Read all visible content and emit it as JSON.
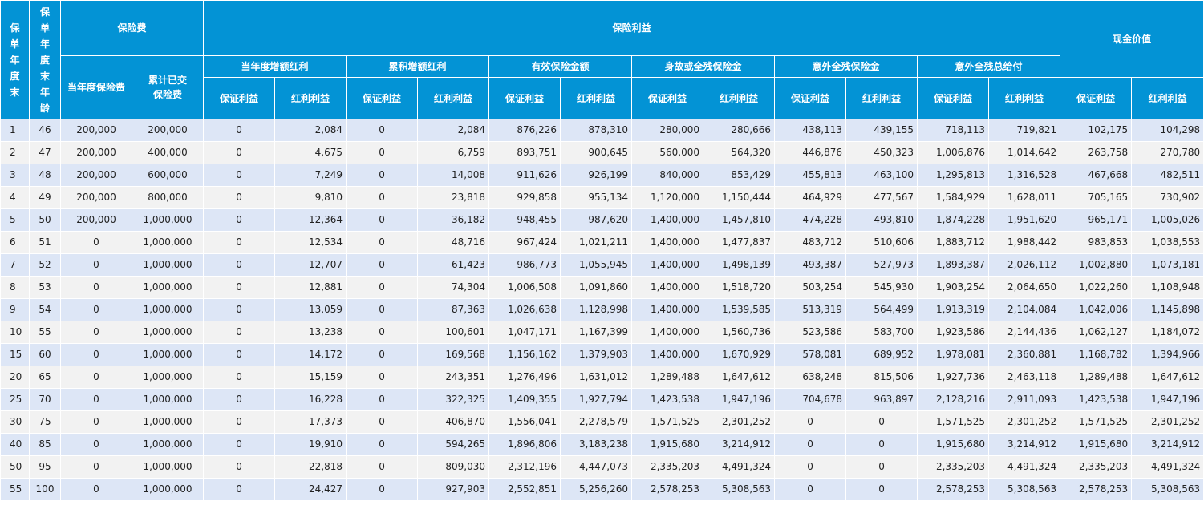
{
  "header": {
    "year_col": "保\n单\n年\n度\n末",
    "age_col": "保\n单\n年\n度\n末\n年\n龄",
    "premium_group": "保险费",
    "benefit_group": "保险利益",
    "cash_value_group": "现金价值",
    "premium_current": "当年度保险费",
    "premium_cumulative": "累计已交保险费",
    "sub_groups": [
      "当年度增额红利",
      "累积增额红利",
      "有效保险金额",
      "身故或全残保险金",
      "意外全残保险金",
      "意外全残总给付"
    ],
    "guaranteed": "保证利益",
    "bonus": "红利利益"
  },
  "rows": [
    [
      "1",
      "46",
      "200,000",
      "200,000",
      "0",
      "2,084",
      "0",
      "2,084",
      "876,226",
      "878,310",
      "280,000",
      "280,666",
      "438,113",
      "439,155",
      "718,113",
      "719,821",
      "102,175",
      "104,298"
    ],
    [
      "2",
      "47",
      "200,000",
      "400,000",
      "0",
      "4,675",
      "0",
      "6,759",
      "893,751",
      "900,645",
      "560,000",
      "564,320",
      "446,876",
      "450,323",
      "1,006,876",
      "1,014,642",
      "263,758",
      "270,780"
    ],
    [
      "3",
      "48",
      "200,000",
      "600,000",
      "0",
      "7,249",
      "0",
      "14,008",
      "911,626",
      "926,199",
      "840,000",
      "853,429",
      "455,813",
      "463,100",
      "1,295,813",
      "1,316,528",
      "467,668",
      "482,511"
    ],
    [
      "4",
      "49",
      "200,000",
      "800,000",
      "0",
      "9,810",
      "0",
      "23,818",
      "929,858",
      "955,134",
      "1,120,000",
      "1,150,444",
      "464,929",
      "477,567",
      "1,584,929",
      "1,628,011",
      "705,165",
      "730,902"
    ],
    [
      "5",
      "50",
      "200,000",
      "1,000,000",
      "0",
      "12,364",
      "0",
      "36,182",
      "948,455",
      "987,620",
      "1,400,000",
      "1,457,810",
      "474,228",
      "493,810",
      "1,874,228",
      "1,951,620",
      "965,171",
      "1,005,026"
    ],
    [
      "6",
      "51",
      "0",
      "1,000,000",
      "0",
      "12,534",
      "0",
      "48,716",
      "967,424",
      "1,021,211",
      "1,400,000",
      "1,477,837",
      "483,712",
      "510,606",
      "1,883,712",
      "1,988,442",
      "983,853",
      "1,038,553"
    ],
    [
      "7",
      "52",
      "0",
      "1,000,000",
      "0",
      "12,707",
      "0",
      "61,423",
      "986,773",
      "1,055,945",
      "1,400,000",
      "1,498,139",
      "493,387",
      "527,973",
      "1,893,387",
      "2,026,112",
      "1,002,880",
      "1,073,181"
    ],
    [
      "8",
      "53",
      "0",
      "1,000,000",
      "0",
      "12,881",
      "0",
      "74,304",
      "1,006,508",
      "1,091,860",
      "1,400,000",
      "1,518,720",
      "503,254",
      "545,930",
      "1,903,254",
      "2,064,650",
      "1,022,260",
      "1,108,948"
    ],
    [
      "9",
      "54",
      "0",
      "1,000,000",
      "0",
      "13,059",
      "0",
      "87,363",
      "1,026,638",
      "1,128,998",
      "1,400,000",
      "1,539,585",
      "513,319",
      "564,499",
      "1,913,319",
      "2,104,084",
      "1,042,006",
      "1,145,898"
    ],
    [
      "10",
      "55",
      "0",
      "1,000,000",
      "0",
      "13,238",
      "0",
      "100,601",
      "1,047,171",
      "1,167,399",
      "1,400,000",
      "1,560,736",
      "523,586",
      "583,700",
      "1,923,586",
      "2,144,436",
      "1,062,127",
      "1,184,072"
    ],
    [
      "15",
      "60",
      "0",
      "1,000,000",
      "0",
      "14,172",
      "0",
      "169,568",
      "1,156,162",
      "1,379,903",
      "1,400,000",
      "1,670,929",
      "578,081",
      "689,952",
      "1,978,081",
      "2,360,881",
      "1,168,782",
      "1,394,966"
    ],
    [
      "20",
      "65",
      "0",
      "1,000,000",
      "0",
      "15,159",
      "0",
      "243,351",
      "1,276,496",
      "1,631,012",
      "1,289,488",
      "1,647,612",
      "638,248",
      "815,506",
      "1,927,736",
      "2,463,118",
      "1,289,488",
      "1,647,612"
    ],
    [
      "25",
      "70",
      "0",
      "1,000,000",
      "0",
      "16,228",
      "0",
      "322,325",
      "1,409,355",
      "1,927,794",
      "1,423,538",
      "1,947,196",
      "704,678",
      "963,897",
      "2,128,216",
      "2,911,093",
      "1,423,538",
      "1,947,196"
    ],
    [
      "30",
      "75",
      "0",
      "1,000,000",
      "0",
      "17,373",
      "0",
      "406,870",
      "1,556,041",
      "2,278,579",
      "1,571,525",
      "2,301,252",
      "0",
      "0",
      "1,571,525",
      "2,301,252",
      "1,571,525",
      "2,301,252"
    ],
    [
      "40",
      "85",
      "0",
      "1,000,000",
      "0",
      "19,910",
      "0",
      "594,265",
      "1,896,806",
      "3,183,238",
      "1,915,680",
      "3,214,912",
      "0",
      "0",
      "1,915,680",
      "3,214,912",
      "1,915,680",
      "3,214,912"
    ],
    [
      "50",
      "95",
      "0",
      "1,000,000",
      "0",
      "22,818",
      "0",
      "809,030",
      "2,312,196",
      "4,447,073",
      "2,335,203",
      "4,491,324",
      "0",
      "0",
      "2,335,203",
      "4,491,324",
      "2,335,203",
      "4,491,324"
    ],
    [
      "55",
      "100",
      "0",
      "1,000,000",
      "0",
      "24,427",
      "0",
      "927,903",
      "2,552,851",
      "5,256,260",
      "2,578,253",
      "5,308,563",
      "0",
      "0",
      "2,578,253",
      "5,308,563",
      "2,578,253",
      "5,308,563"
    ]
  ]
}
